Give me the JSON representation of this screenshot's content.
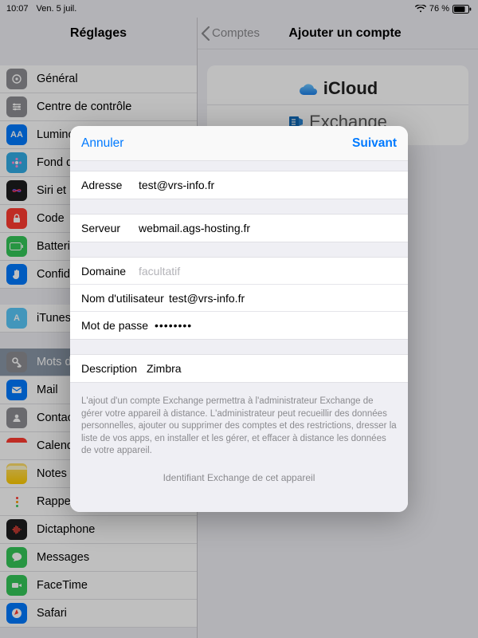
{
  "status": {
    "time": "10:07",
    "date": "Ven. 5 juil.",
    "battery": "76 %"
  },
  "left": {
    "title": "Réglages",
    "groups": [
      [
        {
          "label": "Général",
          "icon": "gear",
          "bg": "bg-grey"
        },
        {
          "label": "Centre de contrôle",
          "icon": "sliders",
          "bg": "bg-grey"
        },
        {
          "label": "Luminosité et affichage",
          "icon": "AA",
          "bg": "bg-blue",
          "text": true
        },
        {
          "label": "Fond d'écran",
          "icon": "flower",
          "bg": "bg-cyan"
        },
        {
          "label": "Siri et recherche",
          "icon": "siri",
          "bg": "bg-dark"
        },
        {
          "label": "Code",
          "icon": "lock",
          "bg": "bg-red"
        },
        {
          "label": "Batterie",
          "icon": "battery",
          "bg": "bg-green"
        },
        {
          "label": "Confidentialité",
          "icon": "hand",
          "bg": "bg-hand"
        }
      ],
      [
        {
          "label": "iTunes Store et App Store",
          "icon": "A",
          "bg": "bg-lightblue",
          "text": true
        }
      ],
      [
        {
          "label": "Mots de passe et comptes",
          "icon": "key",
          "bg": "bg-grey",
          "selected": true
        },
        {
          "label": "Mail",
          "icon": "mail",
          "bg": "bg-blue"
        },
        {
          "label": "Contacts",
          "icon": "contact",
          "bg": "bg-grey"
        },
        {
          "label": "Calendrier",
          "icon": "calendar",
          "bg": "white-cal"
        },
        {
          "label": "Notes",
          "icon": "notes",
          "bg": "bg-yellow"
        },
        {
          "label": "Rappels",
          "icon": "reminders",
          "bg": "white-rem"
        },
        {
          "label": "Dictaphone",
          "icon": "voice",
          "bg": "bg-dark"
        },
        {
          "label": "Messages",
          "icon": "bubble",
          "bg": "bg-green"
        },
        {
          "label": "FaceTime",
          "icon": "video",
          "bg": "bg-green"
        },
        {
          "label": "Safari",
          "icon": "compass",
          "bg": "bg-blue"
        }
      ]
    ]
  },
  "right": {
    "back": "Comptes",
    "title": "Ajouter un compte",
    "providers": [
      {
        "label": "iCloud",
        "color": "#222",
        "icon": "cloud"
      },
      {
        "label": "Exchange",
        "color": "#0f6cbd",
        "icon": "exchange"
      }
    ]
  },
  "modal": {
    "cancel": "Annuler",
    "next": "Suivant",
    "fields": {
      "address_label": "Adresse",
      "address_value": "test@vrs-info.fr",
      "server_label": "Serveur",
      "server_value": "webmail.ags-hosting.fr",
      "domain_label": "Domaine",
      "domain_placeholder": "facultatif",
      "user_label": "Nom d'utilisateur",
      "user_value": "test@vrs-info.fr",
      "password_label": "Mot de passe",
      "password_value": "••••••••",
      "desc_label": "Description",
      "desc_value": "Zimbra"
    },
    "footer": "L'ajout d'un compte Exchange permettra à l'administrateur Exchange de gérer votre appareil à distance. L'administrateur peut recueillir des données personnelles, ajouter ou supprimer des comptes et des restrictions, dresser la liste de vos apps, en installer et les gérer, et effacer à distance les données de votre appareil.",
    "device_id": "Identifiant Exchange de cet appareil"
  }
}
